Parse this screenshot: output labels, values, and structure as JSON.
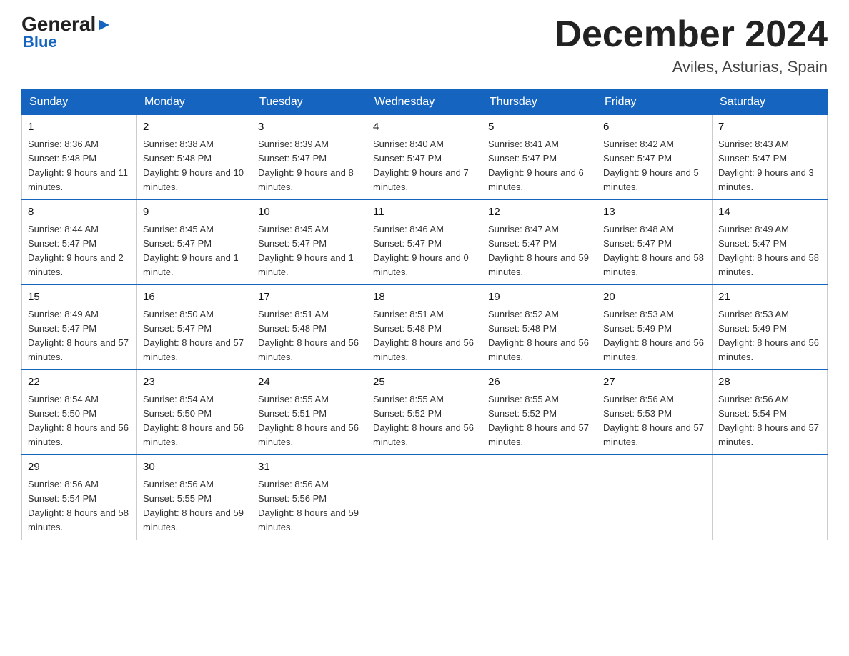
{
  "logo": {
    "general": "General",
    "blue": "Blue",
    "triangle": "▶"
  },
  "title": "December 2024",
  "subtitle": "Aviles, Asturias, Spain",
  "days_of_week": [
    "Sunday",
    "Monday",
    "Tuesday",
    "Wednesday",
    "Thursday",
    "Friday",
    "Saturday"
  ],
  "weeks": [
    [
      {
        "date": "1",
        "sunrise": "8:36 AM",
        "sunset": "5:48 PM",
        "daylight": "9 hours and 11 minutes."
      },
      {
        "date": "2",
        "sunrise": "8:38 AM",
        "sunset": "5:48 PM",
        "daylight": "9 hours and 10 minutes."
      },
      {
        "date": "3",
        "sunrise": "8:39 AM",
        "sunset": "5:47 PM",
        "daylight": "9 hours and 8 minutes."
      },
      {
        "date": "4",
        "sunrise": "8:40 AM",
        "sunset": "5:47 PM",
        "daylight": "9 hours and 7 minutes."
      },
      {
        "date": "5",
        "sunrise": "8:41 AM",
        "sunset": "5:47 PM",
        "daylight": "9 hours and 6 minutes."
      },
      {
        "date": "6",
        "sunrise": "8:42 AM",
        "sunset": "5:47 PM",
        "daylight": "9 hours and 5 minutes."
      },
      {
        "date": "7",
        "sunrise": "8:43 AM",
        "sunset": "5:47 PM",
        "daylight": "9 hours and 3 minutes."
      }
    ],
    [
      {
        "date": "8",
        "sunrise": "8:44 AM",
        "sunset": "5:47 PM",
        "daylight": "9 hours and 2 minutes."
      },
      {
        "date": "9",
        "sunrise": "8:45 AM",
        "sunset": "5:47 PM",
        "daylight": "9 hours and 1 minute."
      },
      {
        "date": "10",
        "sunrise": "8:45 AM",
        "sunset": "5:47 PM",
        "daylight": "9 hours and 1 minute."
      },
      {
        "date": "11",
        "sunrise": "8:46 AM",
        "sunset": "5:47 PM",
        "daylight": "9 hours and 0 minutes."
      },
      {
        "date": "12",
        "sunrise": "8:47 AM",
        "sunset": "5:47 PM",
        "daylight": "8 hours and 59 minutes."
      },
      {
        "date": "13",
        "sunrise": "8:48 AM",
        "sunset": "5:47 PM",
        "daylight": "8 hours and 58 minutes."
      },
      {
        "date": "14",
        "sunrise": "8:49 AM",
        "sunset": "5:47 PM",
        "daylight": "8 hours and 58 minutes."
      }
    ],
    [
      {
        "date": "15",
        "sunrise": "8:49 AM",
        "sunset": "5:47 PM",
        "daylight": "8 hours and 57 minutes."
      },
      {
        "date": "16",
        "sunrise": "8:50 AM",
        "sunset": "5:47 PM",
        "daylight": "8 hours and 57 minutes."
      },
      {
        "date": "17",
        "sunrise": "8:51 AM",
        "sunset": "5:48 PM",
        "daylight": "8 hours and 56 minutes."
      },
      {
        "date": "18",
        "sunrise": "8:51 AM",
        "sunset": "5:48 PM",
        "daylight": "8 hours and 56 minutes."
      },
      {
        "date": "19",
        "sunrise": "8:52 AM",
        "sunset": "5:48 PM",
        "daylight": "8 hours and 56 minutes."
      },
      {
        "date": "20",
        "sunrise": "8:53 AM",
        "sunset": "5:49 PM",
        "daylight": "8 hours and 56 minutes."
      },
      {
        "date": "21",
        "sunrise": "8:53 AM",
        "sunset": "5:49 PM",
        "daylight": "8 hours and 56 minutes."
      }
    ],
    [
      {
        "date": "22",
        "sunrise": "8:54 AM",
        "sunset": "5:50 PM",
        "daylight": "8 hours and 56 minutes."
      },
      {
        "date": "23",
        "sunrise": "8:54 AM",
        "sunset": "5:50 PM",
        "daylight": "8 hours and 56 minutes."
      },
      {
        "date": "24",
        "sunrise": "8:55 AM",
        "sunset": "5:51 PM",
        "daylight": "8 hours and 56 minutes."
      },
      {
        "date": "25",
        "sunrise": "8:55 AM",
        "sunset": "5:52 PM",
        "daylight": "8 hours and 56 minutes."
      },
      {
        "date": "26",
        "sunrise": "8:55 AM",
        "sunset": "5:52 PM",
        "daylight": "8 hours and 57 minutes."
      },
      {
        "date": "27",
        "sunrise": "8:56 AM",
        "sunset": "5:53 PM",
        "daylight": "8 hours and 57 minutes."
      },
      {
        "date": "28",
        "sunrise": "8:56 AM",
        "sunset": "5:54 PM",
        "daylight": "8 hours and 57 minutes."
      }
    ],
    [
      {
        "date": "29",
        "sunrise": "8:56 AM",
        "sunset": "5:54 PM",
        "daylight": "8 hours and 58 minutes."
      },
      {
        "date": "30",
        "sunrise": "8:56 AM",
        "sunset": "5:55 PM",
        "daylight": "8 hours and 59 minutes."
      },
      {
        "date": "31",
        "sunrise": "8:56 AM",
        "sunset": "5:56 PM",
        "daylight": "8 hours and 59 minutes."
      },
      null,
      null,
      null,
      null
    ]
  ]
}
